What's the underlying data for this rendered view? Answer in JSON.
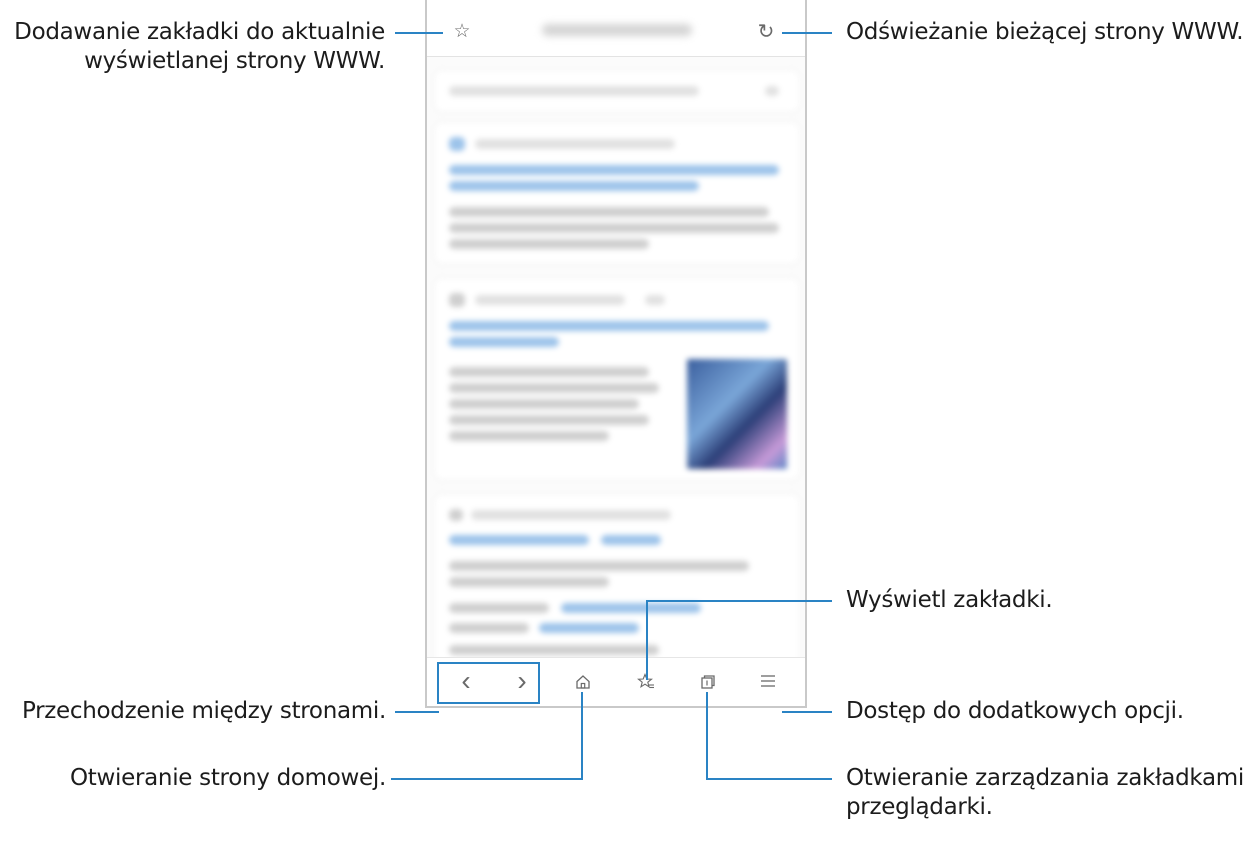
{
  "callouts": {
    "bookmark_add_line1": "Dodawanie zakładki do aktualnie",
    "bookmark_add_line2": "wyświetlanej strony WWW.",
    "refresh": "Odświeżanie bieżącej strony WWW.",
    "view_bookmarks": "Wyświetl zakładki.",
    "navigate": "Przechodzenie między stronami.",
    "more_options": "Dostęp do dodatkowych opcji.",
    "home": "Otwieranie strony domowej.",
    "tabs_line1": "Otwieranie zarządzania zakładkami",
    "tabs_line2": "przeglądarki."
  },
  "icons": {
    "bookmark_add": "☆",
    "refresh": "↻",
    "back": "‹",
    "forward": "›",
    "home": "home-icon",
    "bookmarks": "star-list-icon",
    "tabs": "tab-manager-icon",
    "menu": "☰"
  },
  "colors": {
    "callout_line": "#2a83c4",
    "icon": "#6a6a6a"
  }
}
